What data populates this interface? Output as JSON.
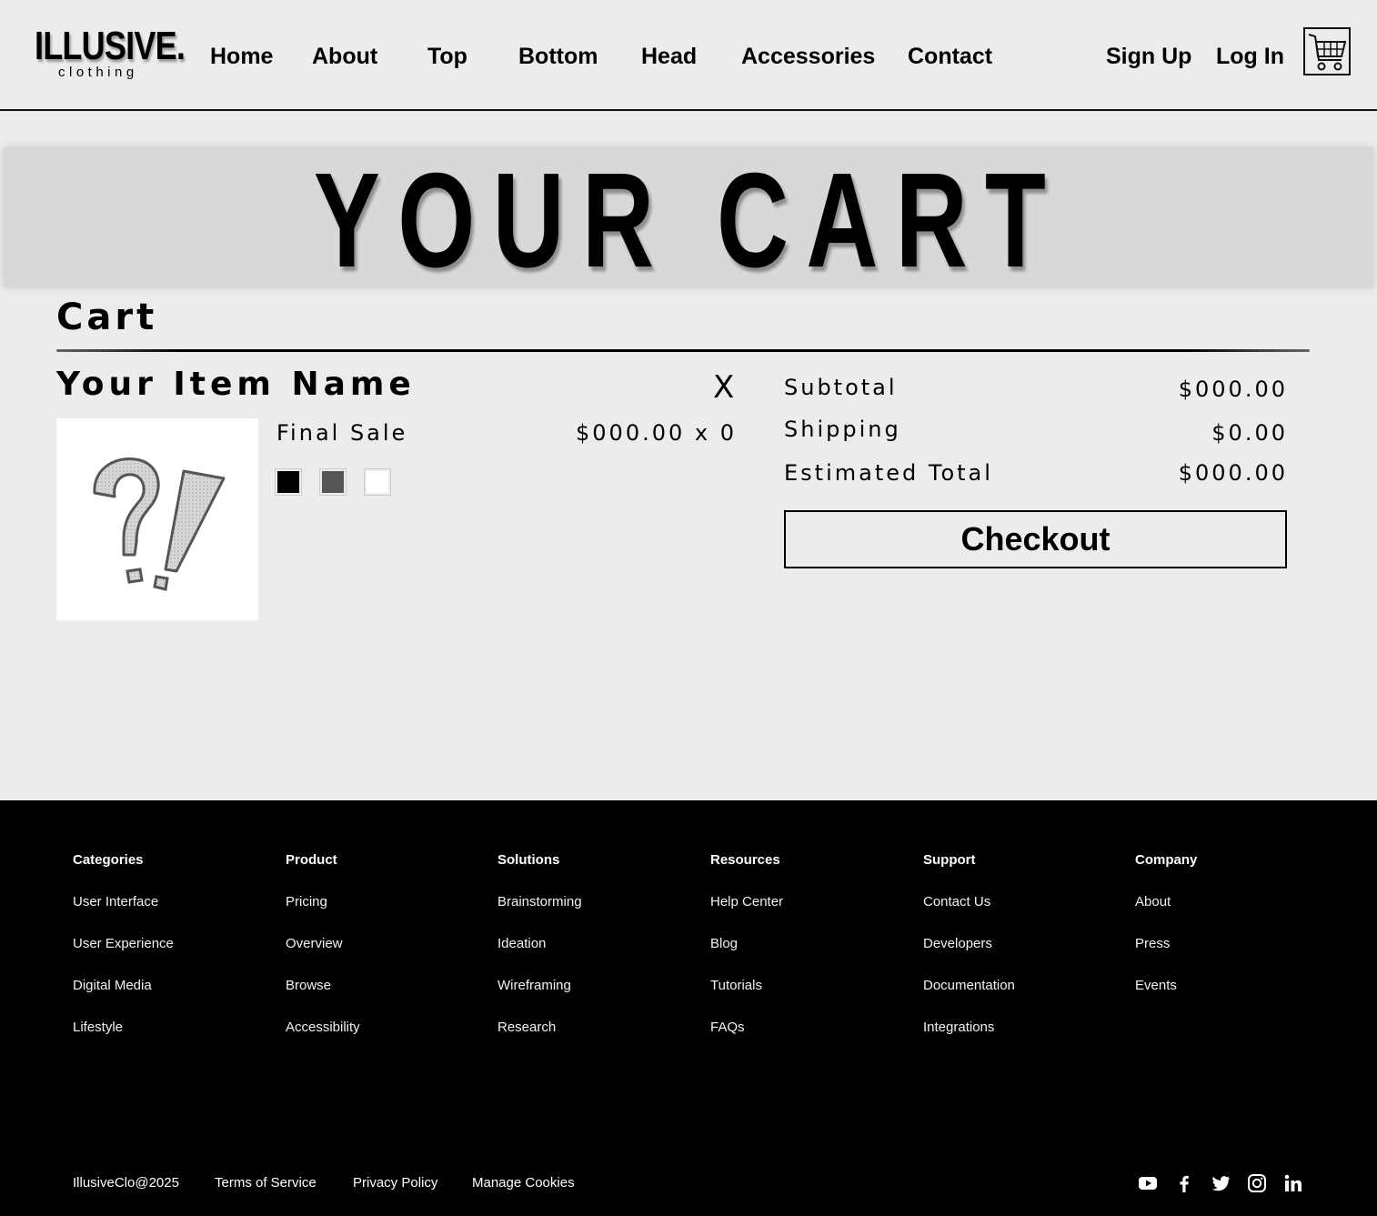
{
  "header": {
    "logo_main": "ILLUSIVE.",
    "logo_sub": "clothing",
    "nav": [
      {
        "label": "Home"
      },
      {
        "label": "About"
      },
      {
        "label": "Top"
      },
      {
        "label": "Bottom"
      },
      {
        "label": "Head"
      },
      {
        "label": "Accessories"
      },
      {
        "label": "Contact"
      }
    ],
    "sign_up": "Sign Up",
    "log_in": "Log In",
    "cart_icon": "shopping-cart-icon"
  },
  "banner": {
    "title": "YOUR CART"
  },
  "cart": {
    "section_title": "Cart",
    "item": {
      "name": "Your Item Name",
      "remove_label": "X",
      "status": "Final Sale",
      "price_qty": "$000.00 x 0",
      "image_icon": "question-exclamation-icon",
      "swatches": [
        "#000000",
        "#555555",
        "#ffffff"
      ]
    }
  },
  "summary": {
    "subtotal_label": "Subtotal",
    "subtotal_value": "$000.00",
    "shipping_label": "Shipping",
    "shipping_value": "$0.00",
    "total_label": "Estimated Total",
    "total_value": "$000.00",
    "checkout_label": "Checkout"
  },
  "footer": {
    "columns": [
      {
        "title": "Categories",
        "links": [
          "User Interface",
          "User Experience",
          "Digital Media",
          "Lifestyle"
        ]
      },
      {
        "title": "Product",
        "links": [
          "Pricing",
          "Overview",
          "Browse",
          "Accessibility"
        ]
      },
      {
        "title": "Solutions",
        "links": [
          "Brainstorming",
          "Ideation",
          "Wireframing",
          "Research"
        ]
      },
      {
        "title": "Resources",
        "links": [
          "Help Center",
          "Blog",
          "Tutorials",
          "FAQs"
        ]
      },
      {
        "title": "Support",
        "links": [
          "Contact Us",
          "Developers",
          "Documentation",
          "Integrations"
        ]
      },
      {
        "title": "Company",
        "links": [
          "About",
          "Press",
          "Events"
        ]
      }
    ],
    "copyright": "IllusiveClo@2025",
    "terms": "Terms of Service",
    "privacy": "Privacy Policy",
    "cookies": "Manage Cookies",
    "social_icons": [
      "youtube-icon",
      "facebook-icon",
      "twitter-icon",
      "instagram-icon",
      "linkedin-icon"
    ]
  }
}
